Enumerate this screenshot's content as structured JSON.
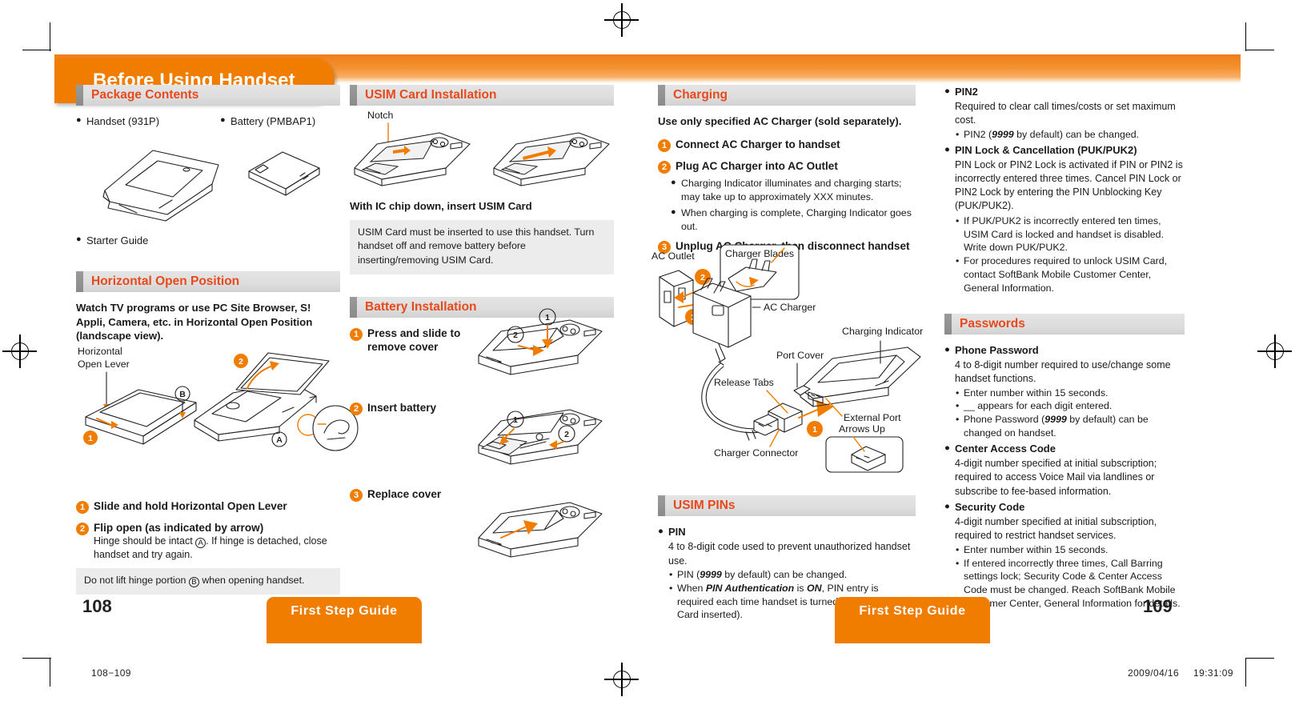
{
  "header": {
    "title": "Before Using Handset"
  },
  "col1": {
    "package": {
      "heading": "Package Contents",
      "items": [
        {
          "label": "Handset (931P)"
        },
        {
          "label": "Battery (PMBAP1)"
        },
        {
          "label": "Starter Guide"
        }
      ]
    },
    "horizontal": {
      "heading": "Horizontal Open Position",
      "intro": "Watch TV programs or use PC Site Browser, S! Appli, Camera, etc. in Horizontal Open Position (landscape view).",
      "callouts": {
        "lever": "Horizontal",
        "lever2": "Open Lever",
        "markA": "A",
        "markB": "B",
        "num1": "1",
        "num2": "2"
      },
      "steps": [
        {
          "num": "1",
          "text": "Slide and hold Horizontal Open Lever"
        },
        {
          "num": "2",
          "text": "Flip open (as indicated by arrow)"
        }
      ],
      "step2_note_a": "Hinge should be intact ",
      "step2_note_b": ". If hinge is detached, close handset and try again.",
      "warn_a": "Do not lift hinge portion ",
      "warn_b": " when opening handset."
    }
  },
  "col2": {
    "usim": {
      "heading": "USIM Card Installation",
      "notch_label": "Notch",
      "caption": "With IC chip down, insert USIM Card",
      "note": "USIM Card must be inserted to use this handset. Turn handset off and remove battery before inserting/removing USIM Card."
    },
    "battery": {
      "heading": "Battery Installation",
      "steps": [
        {
          "num": "1",
          "text": "Press and slide to remove cover"
        },
        {
          "num": "2",
          "text": "Insert battery"
        },
        {
          "num": "3",
          "text": "Replace cover"
        }
      ]
    }
  },
  "col3": {
    "charging": {
      "heading": "Charging",
      "intro": "Use only specified AC Charger (sold separately).",
      "steps": [
        {
          "num": "1",
          "text": "Connect AC Charger to handset"
        },
        {
          "num": "2",
          "text": "Plug AC Charger into AC Outlet"
        },
        {
          "num": "3",
          "text": "Unplug AC Charger, then disconnect handset"
        }
      ],
      "bullets": [
        "Charging Indicator illuminates and charging starts; may take up to approximately XXX minutes.",
        "When charging is complete, Charging Indicator goes out."
      ],
      "diagram_labels": {
        "ac_outlet": "AC Outlet",
        "charger_blades": "Charger Blades",
        "ac_charger": "AC Charger",
        "charging_indicator": "Charging Indicator",
        "port_cover": "Port Cover",
        "release_tabs": "Release Tabs",
        "external_port": "External Port",
        "arrows_up": "Arrows Up",
        "charger_connector": "Charger Connector",
        "n1": "1",
        "n2": "2",
        "n3": "3"
      }
    },
    "usim_pins": {
      "heading": "USIM PINs",
      "pin": {
        "title": "PIN",
        "desc": "4 to 8-digit code used to prevent unauthorized handset use.",
        "b1_pre": "PIN (",
        "b1_em": "9999",
        "b1_post": " by default) can be changed.",
        "b2_pre": "When ",
        "b2_em1": "PIN Authentication",
        "b2_mid": " is ",
        "b2_em2": "ON",
        "b2_post": ", PIN entry is required each time handset is turned on (with USIM Card inserted)."
      }
    }
  },
  "col4": {
    "pin2": {
      "title": "PIN2",
      "desc": "Required to clear call times/costs or set maximum cost.",
      "b1_pre": "PIN2 (",
      "b1_em": "9999",
      "b1_post": " by default) can be changed."
    },
    "pinlock": {
      "title": "PIN Lock & Cancellation (PUK/PUK2)",
      "desc": "PIN Lock or PIN2 Lock is activated if PIN or PIN2 is incorrectly entered three times. Cancel PIN Lock or PIN2 Lock by entering the PIN Unblocking Key (PUK/PUK2).",
      "bullets": [
        "If PUK/PUK2 is incorrectly entered ten times, USIM Card is locked and handset is disabled. Write down PUK/PUK2.",
        "For procedures required to unlock USIM Card, contact SoftBank Mobile Customer Center, General Information."
      ]
    },
    "passwords": {
      "heading": "Passwords",
      "phone": {
        "title": "Phone Password",
        "desc": "4 to 8-digit number required to use/change some handset functions.",
        "b1": "Enter number within 15 seconds.",
        "b2": "__  appears for each digit entered.",
        "b3_pre": "Phone Password (",
        "b3_em": "9999",
        "b3_post": " by default) can be changed on handset."
      },
      "center": {
        "title": "Center Access Code",
        "desc": "4-digit number specified at initial subscription; required to access Voice Mail via landlines or subscribe to fee-based information."
      },
      "security": {
        "title": "Security Code",
        "desc": "4-digit number specified at initial subscription, required to restrict handset services.",
        "b1": "Enter number within 15 seconds.",
        "b2": "If entered incorrectly three times, Call Barring settings lock; Security Code & Center Access Code must be changed. Reach SoftBank Mobile Customer Center, General Information for details."
      }
    }
  },
  "footer": {
    "page_left": "108",
    "page_right": "109",
    "banner_label": "First Step Guide",
    "file_label": "108−109",
    "date": "2009/04/16",
    "time": "19:31:09"
  },
  "colors": {
    "orange": "#f07d00",
    "heading_red": "#e8491b",
    "section_gray": "#dedede",
    "tab_gray": "#8a8a8a",
    "note_gray": "#ececec"
  }
}
